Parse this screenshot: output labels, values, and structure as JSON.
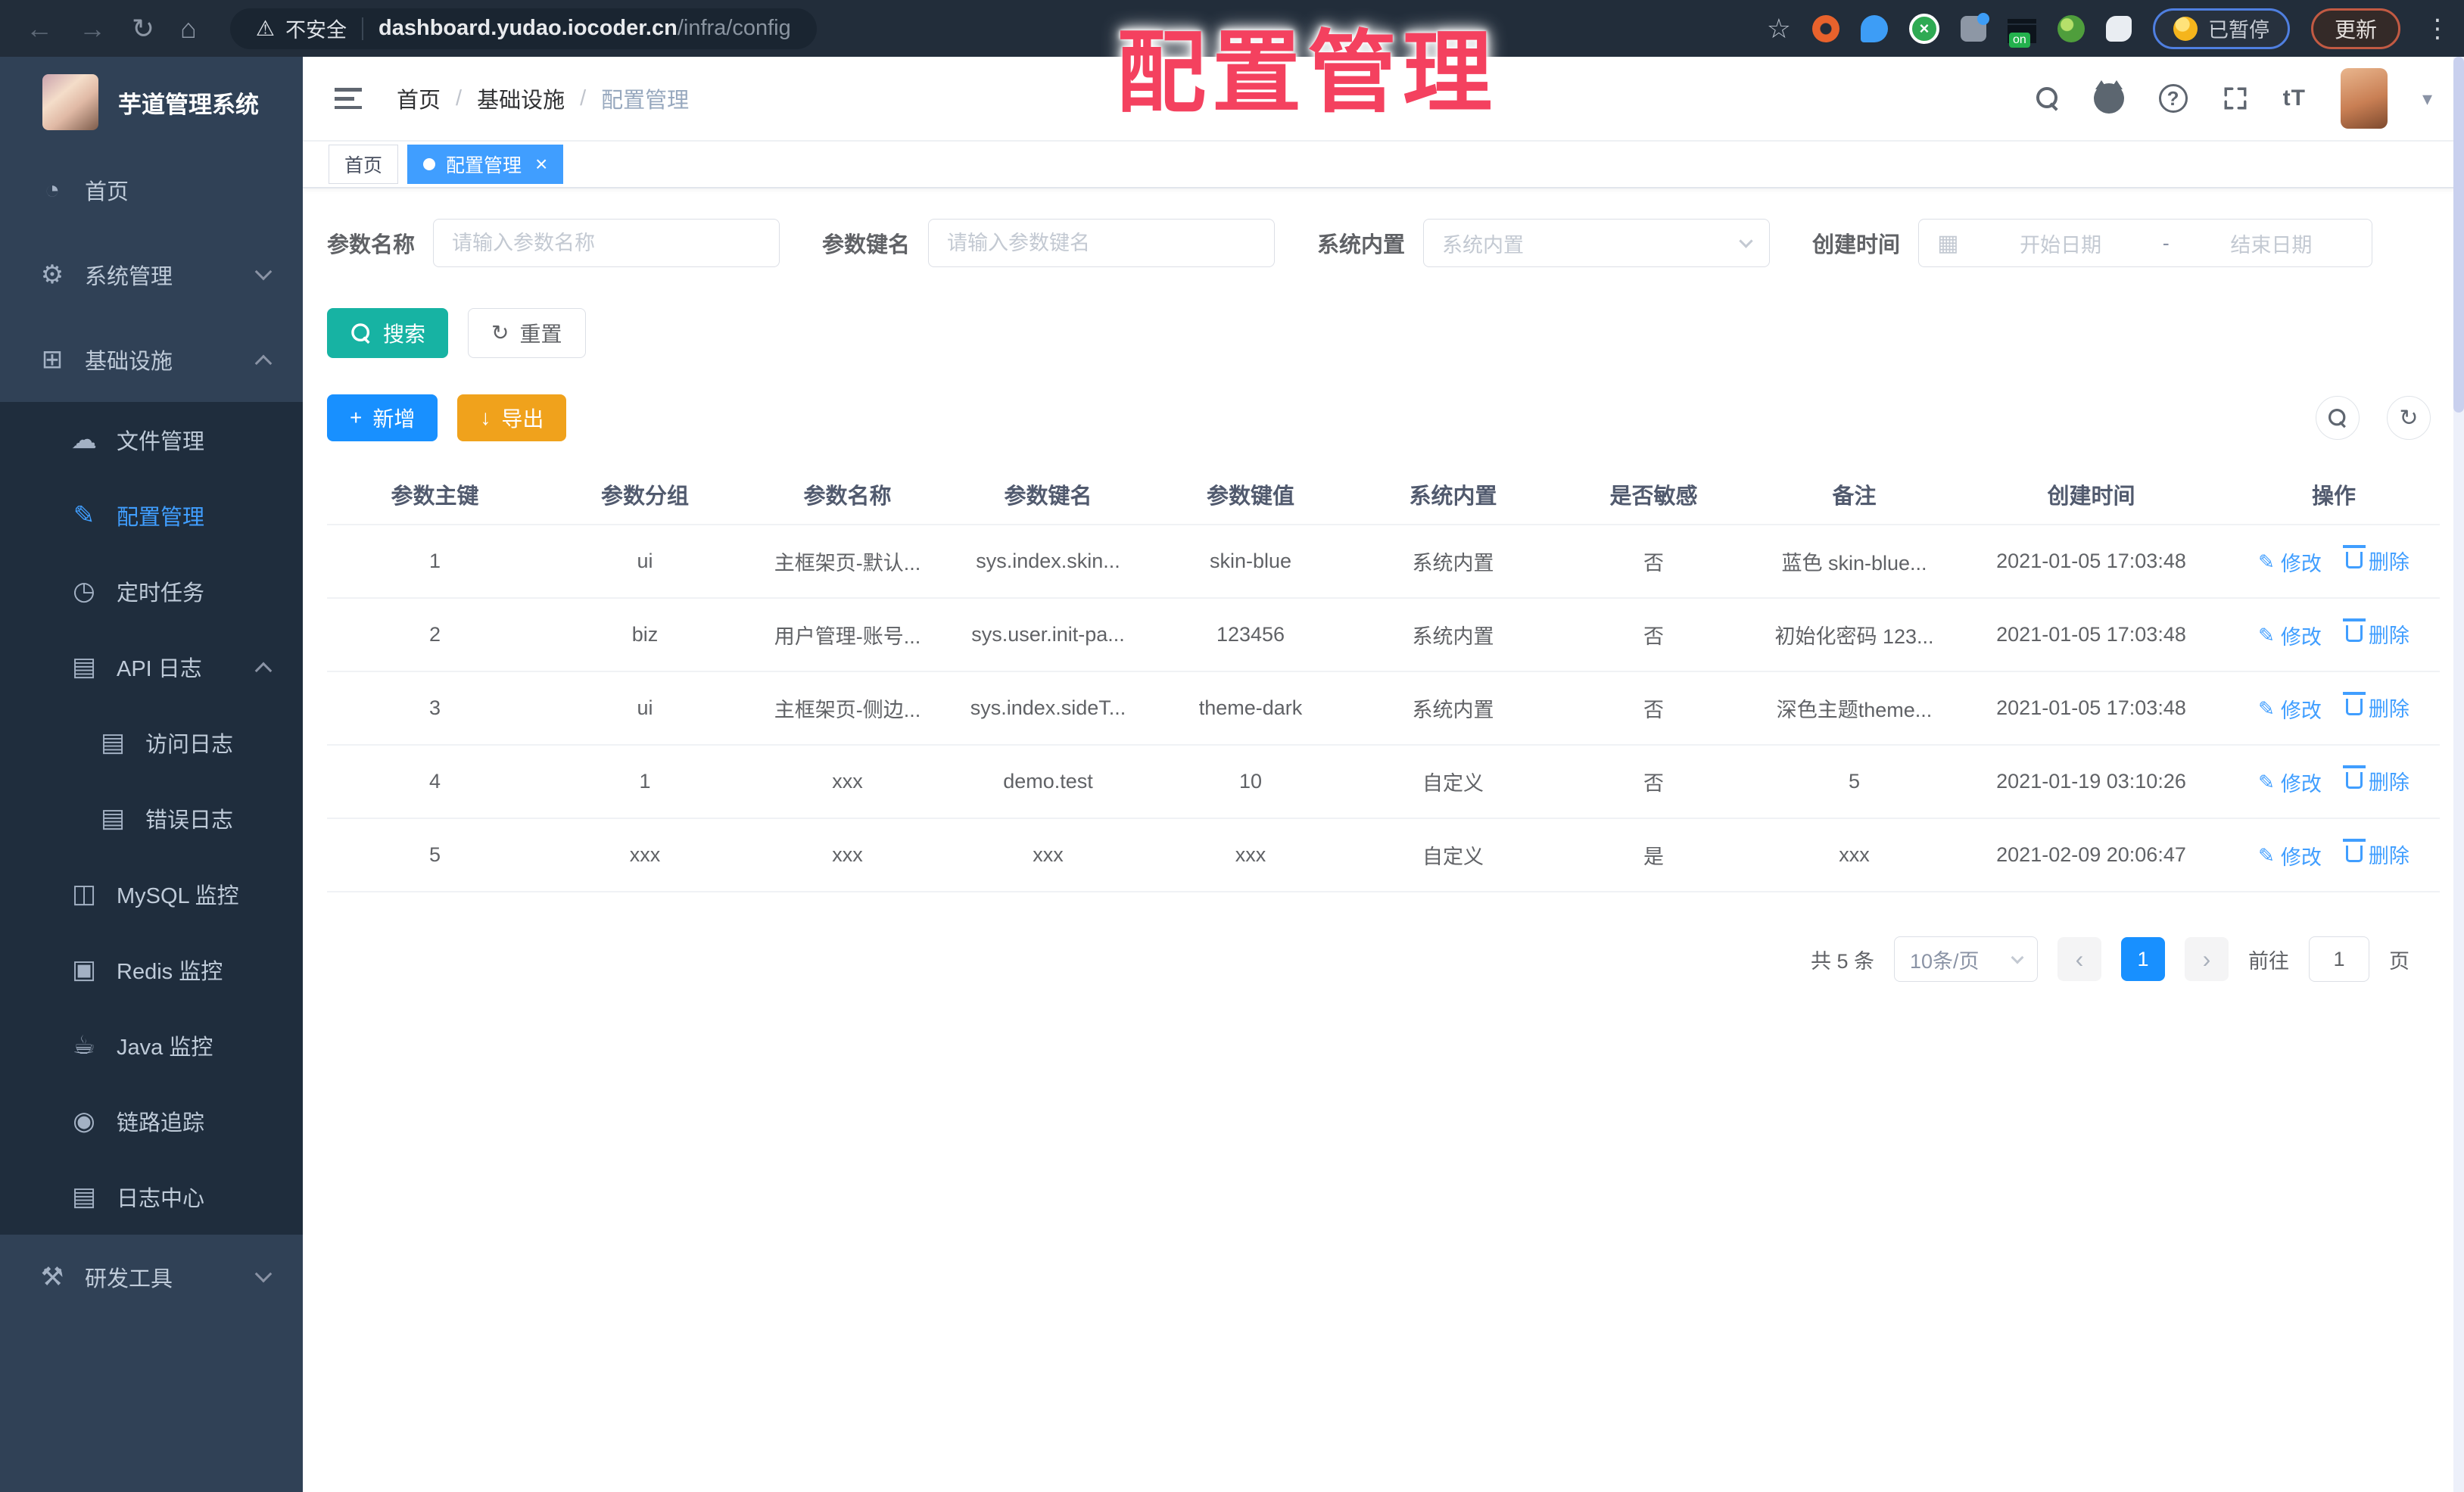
{
  "colors": {
    "accent": "#409eff",
    "primary_button": "#1890ff",
    "success_teal": "#17b3a3",
    "warning_orange": "#f0a21c",
    "overlay_red": "#f4415f",
    "sidebar_bg": "#304156",
    "submenu_bg": "#1f2d3d"
  },
  "icons": {
    "back": "←",
    "forward": "→",
    "reload": "↻",
    "home": "⌂",
    "warning": "⚠",
    "star": "☆",
    "dots_vertical": "⋮",
    "dashboard": "◔",
    "gear": "⚙",
    "infra": "⊞",
    "cloud": "☁",
    "pencil": "✎",
    "clock": "◷",
    "log": "▤",
    "mysql": "◫",
    "redis": "▣",
    "java": "☕",
    "trace": "◉",
    "tools": "⚒",
    "refresh": "↻",
    "plus": "+",
    "download": "↓",
    "calendar": "▦",
    "prev": "‹",
    "next": "›",
    "close": "×",
    "caret_down": "▾",
    "question": "?",
    "font_size": "tT"
  },
  "browser": {
    "security_label": "不安全",
    "url_host": "dashboard.yudao.iocoder.cn",
    "url_path": "/infra/config",
    "paused_label": "已暂停",
    "update_label": "更新"
  },
  "overlay_title": "配置管理",
  "sidebar": {
    "app_title": "芋道管理系统",
    "items": [
      {
        "label": "首页"
      },
      {
        "label": "系统管理"
      },
      {
        "label": "基础设施"
      },
      {
        "label": "文件管理"
      },
      {
        "label": "配置管理"
      },
      {
        "label": "定时任务"
      },
      {
        "label": "API 日志"
      },
      {
        "label": "访问日志"
      },
      {
        "label": "错误日志"
      },
      {
        "label": "MySQL 监控"
      },
      {
        "label": "Redis 监控"
      },
      {
        "label": "Java 监控"
      },
      {
        "label": "链路追踪"
      },
      {
        "label": "日志中心"
      },
      {
        "label": "研发工具"
      }
    ]
  },
  "header": {
    "breadcrumb": {
      "home": "首页",
      "section": "基础设施",
      "current": "配置管理",
      "separator": "/"
    }
  },
  "tags": {
    "home": "首页",
    "current": "配置管理"
  },
  "filters": {
    "name_label": "参数名称",
    "name_placeholder": "请输入参数名称",
    "key_label": "参数键名",
    "key_placeholder": "请输入参数键名",
    "type_label": "系统内置",
    "type_placeholder": "系统内置",
    "date_label": "创建时间",
    "date_start_placeholder": "开始日期",
    "date_separator": "-",
    "date_end_placeholder": "结束日期",
    "search_label": "搜索",
    "reset_label": "重置"
  },
  "toolbar": {
    "add_label": "新增",
    "export_label": "导出"
  },
  "table": {
    "columns": [
      "参数主键",
      "参数分组",
      "参数名称",
      "参数键名",
      "参数键值",
      "系统内置",
      "是否敏感",
      "备注",
      "创建时间",
      "操作"
    ],
    "edit_label": "修改",
    "delete_label": "删除",
    "rows": [
      {
        "id": "1",
        "group": "ui",
        "name": "主框架页-默认...",
        "key": "sys.index.skin...",
        "value": "skin-blue",
        "type": "系统内置",
        "sensitive": "否",
        "remark": "蓝色 skin-blue...",
        "created": "2021-01-05 17:03:48"
      },
      {
        "id": "2",
        "group": "biz",
        "name": "用户管理-账号...",
        "key": "sys.user.init-pa...",
        "value": "123456",
        "type": "系统内置",
        "sensitive": "否",
        "remark": "初始化密码 123...",
        "created": "2021-01-05 17:03:48"
      },
      {
        "id": "3",
        "group": "ui",
        "name": "主框架页-侧边...",
        "key": "sys.index.sideT...",
        "value": "theme-dark",
        "type": "系统内置",
        "sensitive": "否",
        "remark": "深色主题theme...",
        "created": "2021-01-05 17:03:48"
      },
      {
        "id": "4",
        "group": "1",
        "name": "xxx",
        "key": "demo.test",
        "value": "10",
        "type": "自定义",
        "sensitive": "否",
        "remark": "5",
        "created": "2021-01-19 03:10:26"
      },
      {
        "id": "5",
        "group": "xxx",
        "name": "xxx",
        "key": "xxx",
        "value": "xxx",
        "type": "自定义",
        "sensitive": "是",
        "remark": "xxx",
        "created": "2021-02-09 20:06:47"
      }
    ]
  },
  "pagination": {
    "total": "共 5 条",
    "page_size": "10条/页",
    "page": "1",
    "goto_label": "前往",
    "goto_value": "1",
    "unit": "页"
  }
}
